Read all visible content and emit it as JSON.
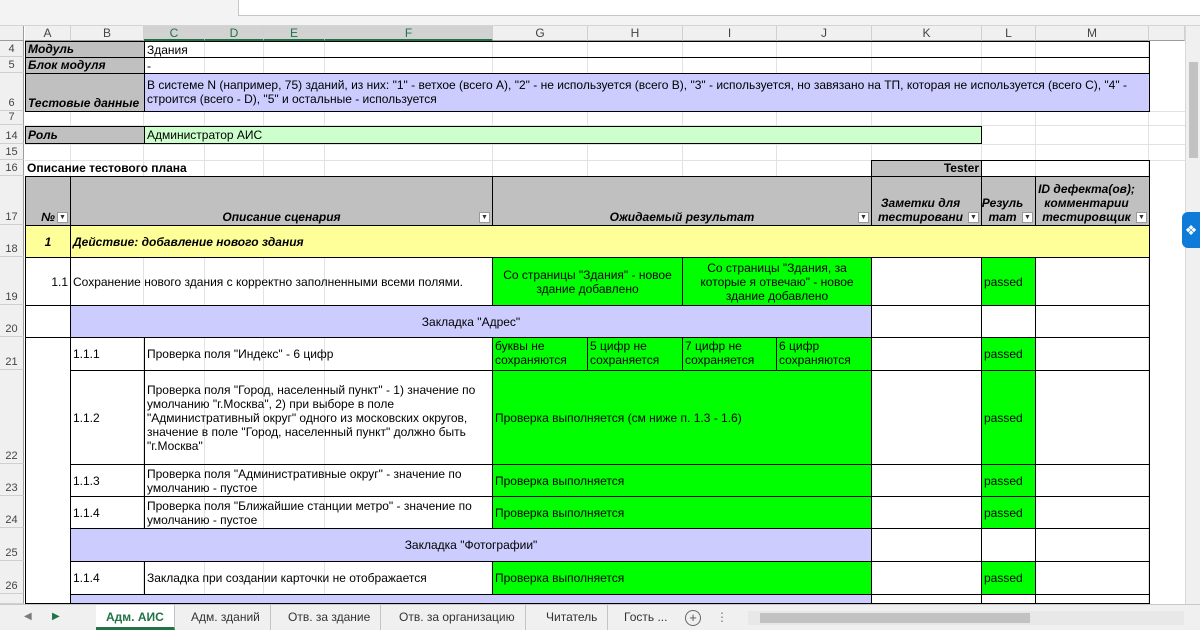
{
  "columns": [
    "A",
    "B",
    "C",
    "D",
    "E",
    "F",
    "G",
    "H",
    "I",
    "J",
    "K",
    "L",
    "M"
  ],
  "rows": [
    "4",
    "5",
    "6",
    "7",
    "14",
    "15",
    "16",
    "17",
    "18",
    "19",
    "20",
    "21",
    "22",
    "23",
    "24",
    "25",
    "26"
  ],
  "header_block": {
    "module_label": "Модуль",
    "module_value": "Здания",
    "block_label": "Блок модуля",
    "block_value": "-",
    "testdata_label": "Тестовые данные",
    "testdata_value": "В системе N (например, 75) зданий, из них: \"1\" - ветхое (всего A), \"2\" - не используется (всего B), \"3\" - используется, но завязано на ТП, которая не используется (всего C), \"4\" - строится (всего - D), \"5\" и остальные - используется",
    "role_label": "Роль",
    "role_value": "Администратор АИС",
    "plan_label": "Описание тестового плана",
    "tester_label": "Tester"
  },
  "table_headers": {
    "num": "№",
    "scenario": "Описание сценария",
    "expected": "Ожидаемый результат",
    "notes": "Заметки для тестировани",
    "result": "Резуль тат",
    "defect": "ID дефекта(ов); комментарии тестировщик"
  },
  "rows_data": {
    "r18_num": "1",
    "r18_text": "Действие: добавление нового здания",
    "r19_num": "1.1",
    "r19_desc": "Сохранение нового здания с корректно заполненными всеми полями.",
    "r19_exp1": "Со страницы \"Здания\" - новое здание добавлено",
    "r19_exp2": "Со страницы \"Здания, за которые я отвечаю\" - новое здание добавлено",
    "r19_res": "passed",
    "r20_tab": "Закладка \"Адрес\"",
    "r21_num": "1.1.1",
    "r21_desc": "Проверка поля \"Индекс\" - 6 цифр",
    "r21_e1": "буквы не сохраняются",
    "r21_e2": "5 цифр не сохраняется",
    "r21_e3": "7 цифр не сохраняется",
    "r21_e4": "6 цифр сохраняются",
    "r21_res": "passed",
    "r22_num": "1.1.2",
    "r22_desc": "Проверка поля \"Город, населенный пункт\" - 1) значение по умолчанию \"г.Москва\", 2) при выборе в поле \"Административный округ\" одного из московских округов, значение в поле \"Город, населенный пункт\" должно быть \"г.Москва\"",
    "r22_exp": "Проверка выполняется (см ниже п. 1.3 - 1.6)",
    "r22_res": "passed",
    "r23_num": "1.1.3",
    "r23_desc": "Проверка поля \"Административные округ\" - значение по умолчанию - пустое",
    "r23_exp": "Проверка выполняется",
    "r23_res": "passed",
    "r24_num": "1.1.4",
    "r24_desc": "Проверка поля \"Ближайшие станции метро\" - значение по умолчанию - пустое",
    "r24_exp": "Проверка выполняется",
    "r24_res": "passed",
    "r25_tab": "Закладка \"Фотографии\"",
    "r26_num": "1.1.4",
    "r26_desc": "Закладка при создании карточки не отображается",
    "r26_exp": "Проверка выполняется",
    "r26_res": "passed"
  },
  "sheet_tabs": [
    "Адм. АИС",
    "Адм. зданий",
    "Отв. за здание",
    "Отв. за организацию",
    "Читатель",
    "Гость ..."
  ],
  "colors": {
    "accent": "#217346",
    "green": "#00ff00",
    "lavender": "#ccccff",
    "mint": "#ccffcc",
    "yellow": "#ffff99",
    "gray": "#c0c0c0"
  }
}
